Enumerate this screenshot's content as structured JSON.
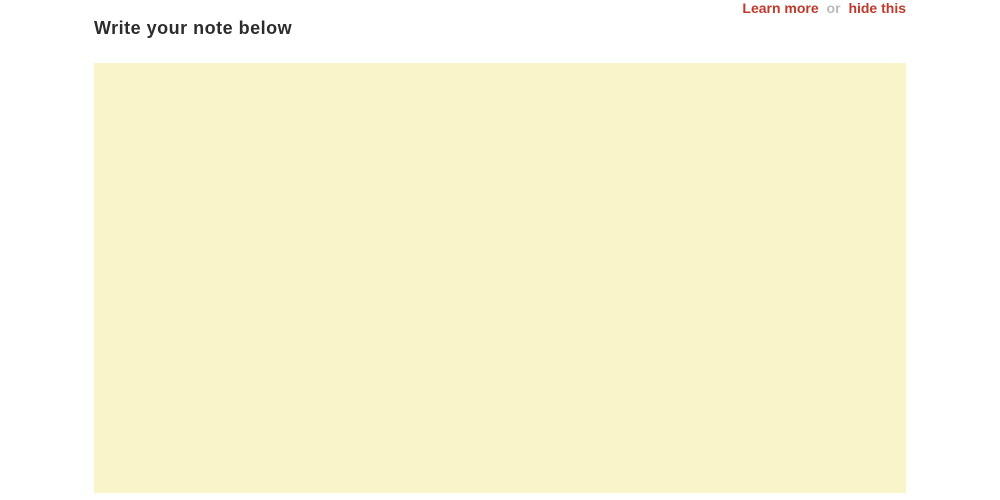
{
  "banner": {
    "learn_more": "Learn more",
    "separator": "or",
    "hide_this": "hide this"
  },
  "heading": "Write your note below",
  "note": {
    "value": "",
    "placeholder": ""
  }
}
